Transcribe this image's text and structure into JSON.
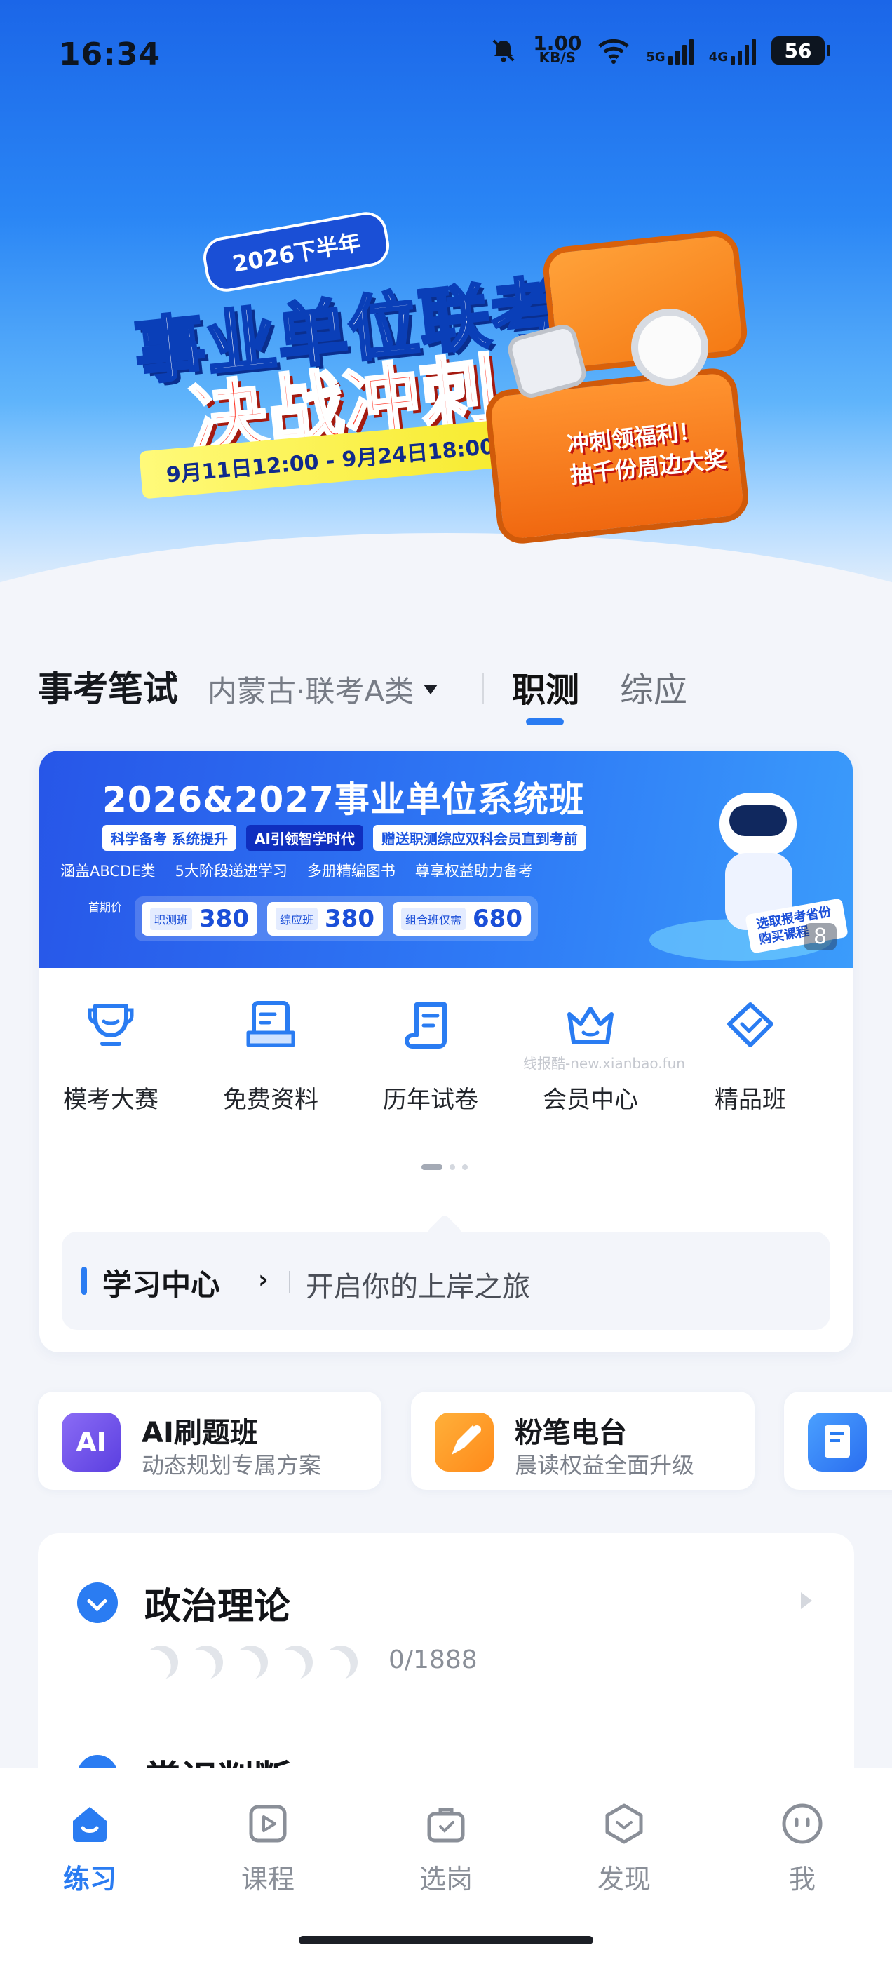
{
  "status_bar": {
    "time": "16:34",
    "speed_value": "1.00",
    "speed_unit": "KB/S",
    "net1": "5G",
    "net2": "4G",
    "battery": "56"
  },
  "hero": {
    "badge": "2026下半年",
    "title_line1": "事业单位联考",
    "title_line2": "决战冲刺",
    "date_range": "9月11日12:00 - 9月24日18:00",
    "promo_line1": "冲刺领福利！",
    "promo_line2": "抽千份周边大奖"
  },
  "exam_selector": {
    "exam": "事考笔试",
    "region": "内蒙古·联考A类",
    "tabs": [
      "职测",
      "综应"
    ]
  },
  "promo_banner": {
    "title": "2026&2027事业单位系统班",
    "tags": [
      "科学备考 系统提升",
      "AI引领智学时代",
      "赠送职测综应双科会员直到考前"
    ],
    "features": [
      "涵盖ABCDE类",
      "5大阶段递进学习",
      "多册精编图书",
      "尊享权益助力备考"
    ],
    "prices_label": "首期价",
    "prices": [
      {
        "name": "职测班",
        "value": "380"
      },
      {
        "name": "综应班",
        "value": "380"
      },
      {
        "name": "组合班仅需",
        "value": "680"
      }
    ],
    "stamp": "选取报考省份购买课程",
    "counter": "8"
  },
  "quick_access": [
    {
      "label": "模考大赛",
      "icon": "trophy-icon"
    },
    {
      "label": "免费资料",
      "icon": "document-tray-icon"
    },
    {
      "label": "历年试卷",
      "icon": "scroll-paper-icon"
    },
    {
      "label": "会员中心",
      "icon": "crown-icon"
    },
    {
      "label": "精品班",
      "icon": "diamond-icon"
    }
  ],
  "watermark": "线报酷-new.xianbao.fun",
  "study_center": {
    "title": "学习中心",
    "subtitle": "开启你的上岸之旅"
  },
  "features": [
    {
      "title": "AI刷题班",
      "subtitle": "动态规划专属方案",
      "color": "#7a5cf0"
    },
    {
      "title": "粉笔电台",
      "subtitle": "晨读权益全面升级",
      "color": "#ff9a2a"
    },
    {
      "title": "",
      "subtitle": "",
      "color": "#2a7cf2"
    }
  ],
  "subjects": [
    {
      "name": "政治理论",
      "progress": "0/1888"
    },
    {
      "name": "常识判断",
      "progress": ""
    }
  ],
  "bottom_nav": [
    {
      "label": "练习",
      "active": true
    },
    {
      "label": "课程",
      "active": false
    },
    {
      "label": "选岗",
      "active": false
    },
    {
      "label": "发现",
      "active": false
    },
    {
      "label": "我",
      "active": false
    }
  ],
  "colors": {
    "accent": "#2a7cf2",
    "hero_top": "#1b66e8"
  }
}
